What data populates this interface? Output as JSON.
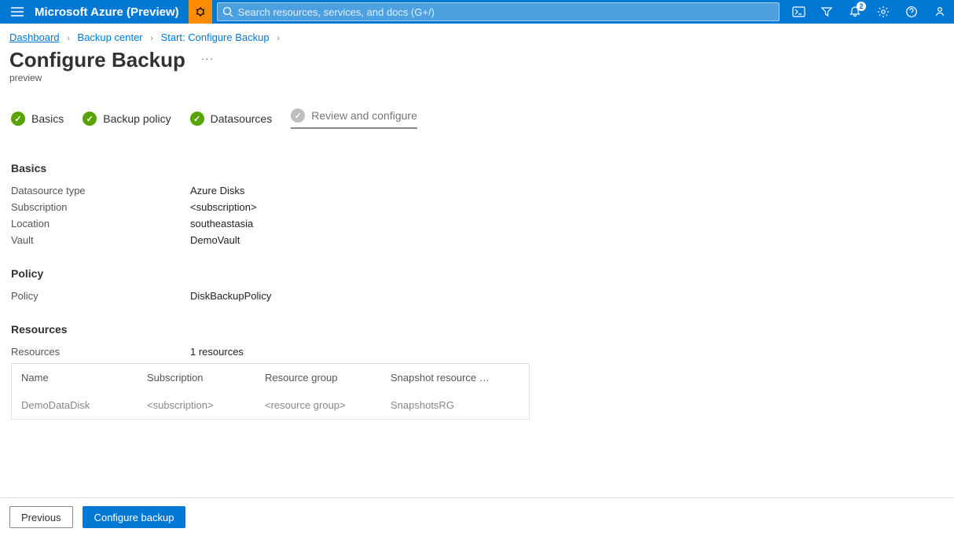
{
  "topbar": {
    "brand": "Microsoft Azure (Preview)",
    "search_placeholder": "Search resources, services, and docs (G+/)",
    "notification_count": "2"
  },
  "breadcrumb": {
    "items": [
      "Dashboard",
      "Backup center",
      "Start: Configure Backup"
    ]
  },
  "page": {
    "title": "Configure Backup",
    "subtitle": "preview"
  },
  "steps": [
    {
      "label": "Basics",
      "state": "done"
    },
    {
      "label": "Backup policy",
      "state": "done"
    },
    {
      "label": "Datasources",
      "state": "done"
    },
    {
      "label": "Review and configure",
      "state": "current"
    }
  ],
  "basics": {
    "heading": "Basics",
    "rows": [
      {
        "k": "Datasource type",
        "v": "Azure Disks"
      },
      {
        "k": "Subscription",
        "v": "<subscription>"
      },
      {
        "k": "Location",
        "v": "southeastasia"
      },
      {
        "k": "Vault",
        "v": "DemoVault"
      }
    ]
  },
  "policy": {
    "heading": "Policy",
    "rows": [
      {
        "k": "Policy",
        "v": "DiskBackupPolicy"
      }
    ]
  },
  "resources": {
    "heading": "Resources",
    "summary_label": "Resources",
    "summary_value": "1 resources",
    "columns": [
      "Name",
      "Subscription",
      "Resource group",
      "Snapshot resource …"
    ],
    "rows": [
      {
        "name": "DemoDataDisk",
        "subscription": "<subscription>",
        "rg": "<resource group>",
        "snap": "SnapshotsRG"
      }
    ]
  },
  "footer": {
    "prev": "Previous",
    "next": "Configure backup"
  }
}
